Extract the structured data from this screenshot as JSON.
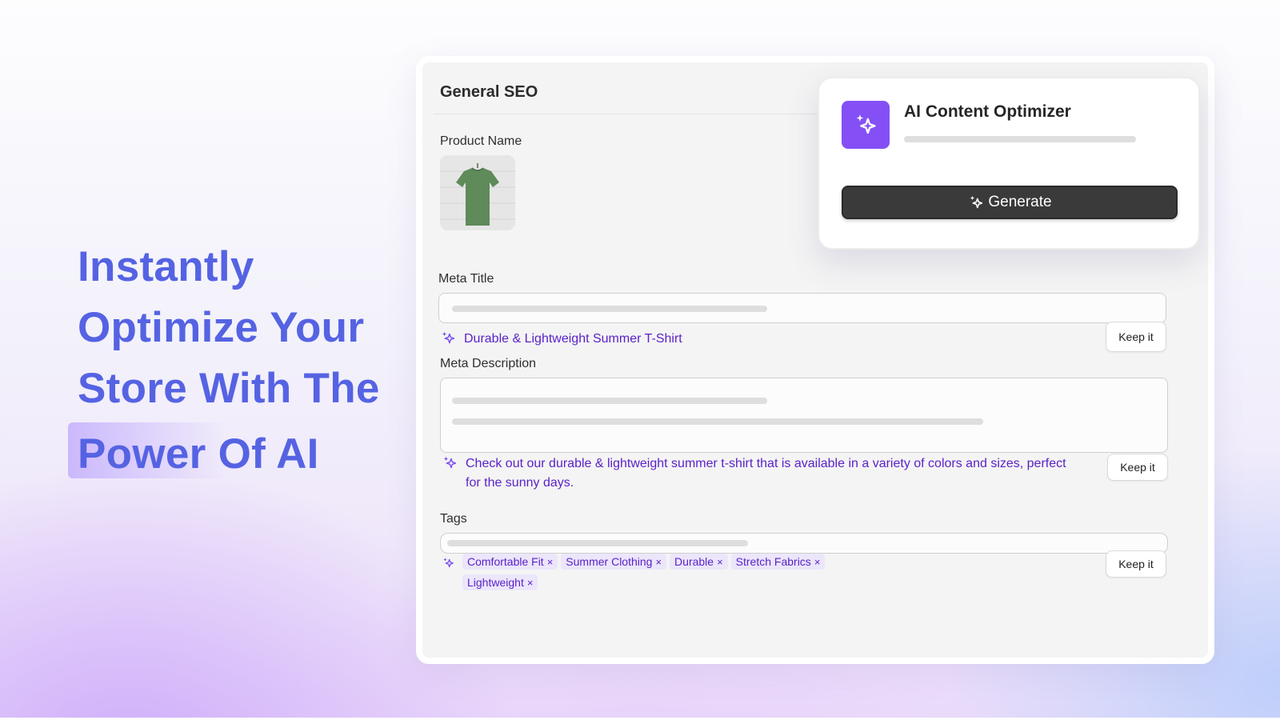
{
  "hero": {
    "lines": [
      "Instantly",
      "Optimize Your",
      "Store With The",
      "Power Of AI"
    ]
  },
  "card": {
    "title": "General SEO",
    "product_name_label": "Product Name",
    "product_image_icon": "t-shirt-image",
    "meta_title": {
      "label": "Meta Title",
      "suggestion": "Durable & Lightweight Summer T-Shirt",
      "keep_label": "Keep it"
    },
    "meta_description": {
      "label": "Meta Description",
      "suggestion": "Check out our durable & lightweight summer t-shirt that is available in a variety of colors and sizes, perfect for the sunny days.",
      "keep_label": "Keep it"
    },
    "tags": {
      "label": "Tags",
      "items": [
        "Comfortable Fit",
        "Summer Clothing",
        "Durable",
        "Stretch Fabrics",
        "Lightweight"
      ],
      "remove_glyph": "×",
      "keep_label": "Keep it"
    }
  },
  "ai_popup": {
    "title": "AI Content Optimizer",
    "logo_icon": "sparkle-icon",
    "generate_label": "Generate"
  },
  "colors": {
    "hero_text": "#5563e3",
    "accent_purple": "#8450f6",
    "suggestion_text": "#5a22c9",
    "tag_bg": "#ece6fb",
    "button_dark": "#3a3a3a"
  }
}
